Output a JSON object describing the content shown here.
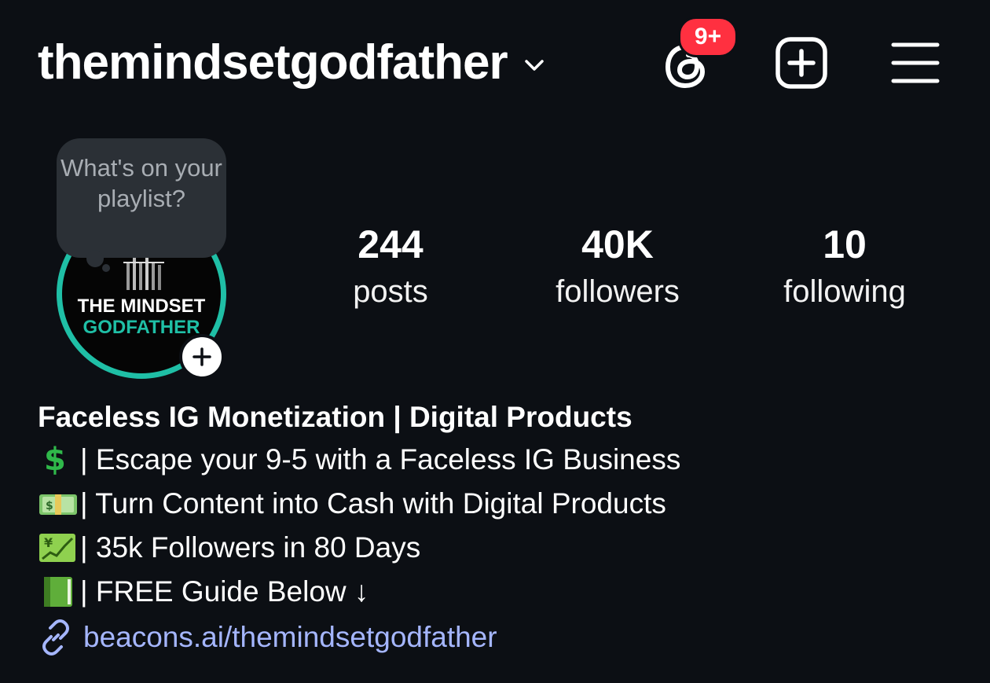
{
  "header": {
    "username": "themindsetgodfather",
    "notification_badge": "9+",
    "colors": {
      "background": "#0c0f14",
      "badge": "#ff3040"
    }
  },
  "note": {
    "text": "What's on your playlist?"
  },
  "avatar": {
    "line1": "THE MINDSET",
    "line2": "GODFATHER",
    "ring_color": "#1fbfa6"
  },
  "stats": [
    {
      "value": "244",
      "label": "posts"
    },
    {
      "value": "40K",
      "label": "followers"
    },
    {
      "value": "10",
      "label": "following"
    }
  ],
  "bio": {
    "title": "Faceless IG Monetization | Digital Products",
    "lines": [
      {
        "icon": "dollar-sign-icon",
        "text": "| Escape your 9-5 with a Faceless IG Business"
      },
      {
        "icon": "money-banknote-icon",
        "text": "| Turn Content into Cash with Digital Products"
      },
      {
        "icon": "chart-increasing-yen-icon",
        "text": "| 35k Followers in 80 Days"
      },
      {
        "icon": "green-book-icon",
        "text": "| FREE Guide Below ↓"
      }
    ],
    "link": "beacons.ai/themindsetgodfather",
    "link_color": "#a5b6ff"
  }
}
